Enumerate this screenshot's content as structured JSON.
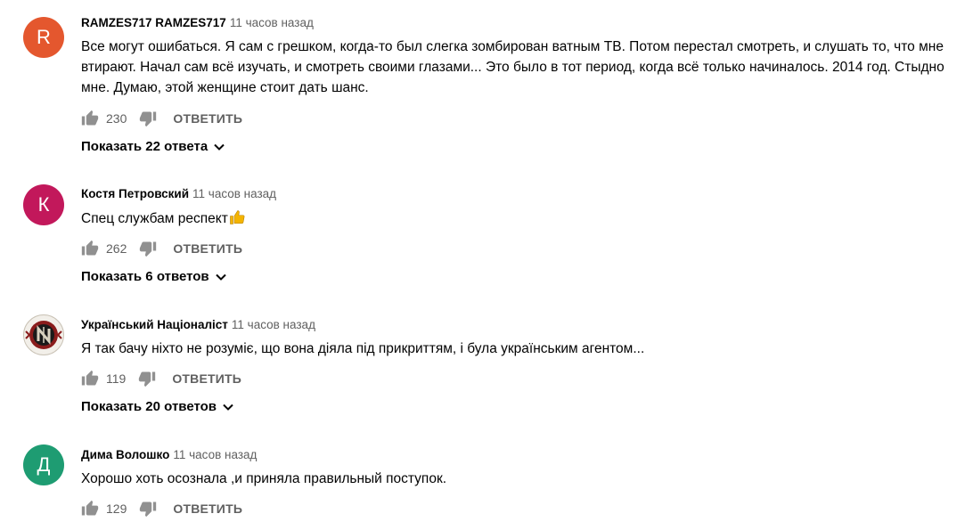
{
  "colors": {
    "avatar_r": "#e4572e",
    "avatar_k": "#c2185b",
    "avatar_d": "#1e9c72",
    "icon_gray": "#909090",
    "text_secondary": "#606060"
  },
  "comments": [
    {
      "avatar_letter": "R",
      "author": "RAMZES717 RAMZES717",
      "time": "11 часов назад",
      "text": "Все могут ошибаться. Я сам с грешком, когда-то был слегка зомбирован ватным ТВ. Потом перестал смотреть, и слушать то, что мне втирают. Начал сам всё изучать, и смотреть своими глазами... Это было в тот период, когда всё только начиналось. 2014 год. Стыдно мне. Думаю, этой женщине стоит дать шанс.",
      "likes": "230",
      "reply_label": "ОТВЕТИТЬ",
      "show_replies": "Показать 22 ответа"
    },
    {
      "avatar_letter": "К",
      "author": "Костя Петровский",
      "time": "11 часов назад",
      "text": "Спец службам респект",
      "likes": "262",
      "reply_label": "ОТВЕТИТЬ",
      "show_replies": "Показать 6 ответов"
    },
    {
      "avatar_letter": "",
      "author": "Український Націоналіст",
      "time": "11 часов назад",
      "text": "Я так бачу ніхто не розуміє, що вона діяла під прикриттям, і була українським агентом...",
      "likes": "119",
      "reply_label": "ОТВЕТИТЬ",
      "show_replies": "Показать 20 ответов"
    },
    {
      "avatar_letter": "Д",
      "author": "Дима Волошко",
      "time": "11 часов назад",
      "text": "Хорошо хоть осознала ,и приняла правильный поступок.",
      "likes": "129",
      "reply_label": "ОТВЕТИТЬ"
    }
  ]
}
